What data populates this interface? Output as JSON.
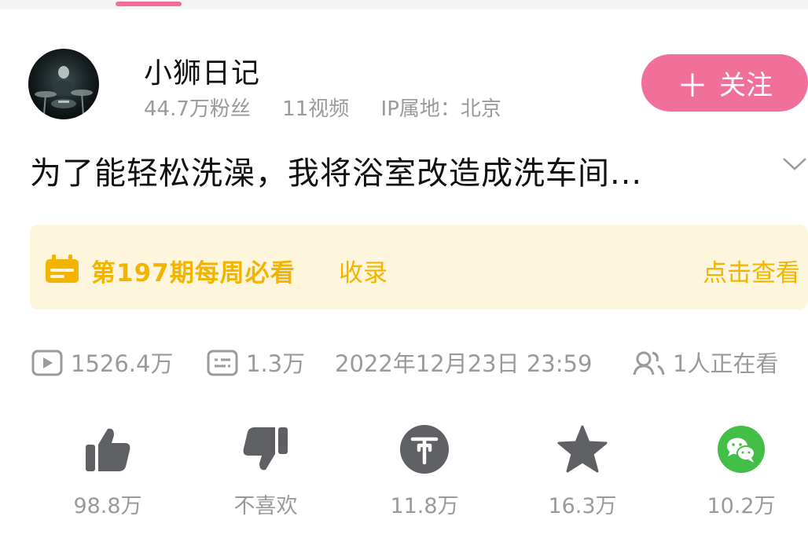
{
  "uploader": {
    "name": "小狮日记",
    "fans": "44.7万粉丝",
    "videos": "11视频",
    "ip": "IP属地：北京",
    "follow_label": "关注",
    "follow_icon": "plus-icon"
  },
  "video": {
    "title": "为了能轻松洗澡，我将浴室改造成洗车间..."
  },
  "banner": {
    "title": "第197期每周必看",
    "tag": "收录",
    "link": "点击查看"
  },
  "stats": {
    "views": "1526.4万",
    "danmaku": "1.3万",
    "datetime": "2022年12月23日 23:59",
    "watching": "1人正在看"
  },
  "actions": [
    {
      "icon": "thumbs-up-icon",
      "label": "98.8万"
    },
    {
      "icon": "thumbs-down-icon",
      "label": "不喜欢"
    },
    {
      "icon": "coin-icon",
      "label": "11.8万"
    },
    {
      "icon": "star-icon",
      "label": "16.3万"
    },
    {
      "icon": "wechat-icon",
      "label": "10.2万"
    }
  ],
  "colors": {
    "accent": "#f0709a",
    "banner_text": "#f3b400",
    "banner_bg": "#fef6dc",
    "icon_gray": "#5f6063",
    "wechat_green": "#43bf48"
  }
}
